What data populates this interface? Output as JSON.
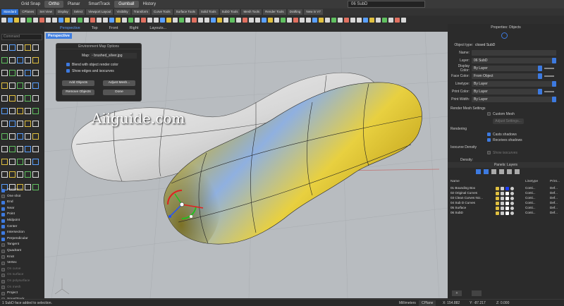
{
  "topbar": {
    "items": [
      "Grid Snap",
      "Ortho",
      "Planar",
      "SmartTrack",
      "Gumball",
      "History"
    ],
    "active": [
      false,
      true,
      false,
      false,
      true,
      false
    ],
    "object_name": "06 SubD"
  },
  "tabs": [
    "Standard",
    "CPlanes",
    "Set View",
    "Display",
    "Select",
    "Viewport Layout",
    "Visibility",
    "Transform",
    "Curve Tools",
    "Surface Tools",
    "Solid Tools",
    "SubD Tools",
    "Mesh Tools",
    "Render Tools",
    "Drafting",
    "New in V7"
  ],
  "left": {
    "command_placeholder": "Command",
    "snaps": [
      {
        "label": "Persistent",
        "on": true
      },
      {
        "label": "One shot",
        "on": false
      },
      {
        "label": "End",
        "on": true
      },
      {
        "label": "Near",
        "on": true
      },
      {
        "label": "Point",
        "on": true
      },
      {
        "label": "Midpoint",
        "on": true
      },
      {
        "label": "Center",
        "on": true
      },
      {
        "label": "Intersection",
        "on": true
      },
      {
        "label": "Perpendicular",
        "on": true
      },
      {
        "label": "Tangent",
        "on": false
      },
      {
        "label": "Quadrant",
        "on": false
      },
      {
        "label": "Knot",
        "on": false
      },
      {
        "label": "Vertex",
        "on": false
      },
      {
        "label": "On curve",
        "on": false,
        "dim": true
      },
      {
        "label": "On surface",
        "on": false,
        "dim": true
      },
      {
        "label": "On polysurface",
        "on": false,
        "dim": true
      },
      {
        "label": "On mesh",
        "on": false,
        "dim": true
      },
      {
        "label": "Project",
        "on": false
      },
      {
        "label": "SmartTrack",
        "on": false
      }
    ]
  },
  "viewport": {
    "tabs": [
      "Perspective",
      "Top",
      "Front",
      "Right",
      "Layouts..."
    ],
    "active_tab": "Perspective",
    "label": "Perspective",
    "watermark": "Aiiguide.com"
  },
  "env_dialog": {
    "title": "Environment Map Options",
    "map_label": "Map:",
    "map_value": "brushed_silver.jpg",
    "blend_label": "Blend with object render color",
    "show_edges_label": "Show edges and isocurves",
    "add_objects": "Add Objects",
    "adjust_mesh": "Adjust Mesh...",
    "remove_objects": "Remove Objects",
    "done": "Done"
  },
  "properties": {
    "header": "Properties: Objects",
    "object_type_label": "Object type:",
    "object_type_value": "closed SubD",
    "name_label": "Name:",
    "layer_label": "Layer:",
    "layer_value": "06 SubD",
    "display_color_label": "Display Color:",
    "display_color_value": "By Layer",
    "face_color_label": "Face Color:",
    "face_color_value": "From Object",
    "linetype_label": "Linetype:",
    "linetype_value": "By Layer",
    "print_color_label": "Print Color:",
    "print_color_value": "By Layer",
    "print_width_label": "Print Width:",
    "print_width_value": "By Layer",
    "render_mesh_label": "Render Mesh Settings",
    "custom_mesh_label": "Custom Mesh",
    "adjust_settings": "Adjust Settings...",
    "rendering_label": "Rendering",
    "casts_shadows": "Casts shadows",
    "receives_shadows": "Receives shadows",
    "isocurve_label": "Isocurve Density",
    "show_isocurves": "Show isocurves",
    "density_label": "Density:"
  },
  "layers": {
    "header": "Panels: Layers",
    "col_name": "Name",
    "col_linetype": "Linetype",
    "col_print": "Print...",
    "rows": [
      {
        "name": "01 Bounding Box",
        "linetype": "Conti...",
        "print": "Def...",
        "color": "#1a3cff"
      },
      {
        "name": "02 Original Curves",
        "linetype": "Conti...",
        "print": "Def...",
        "color": "#ffffff"
      },
      {
        "name": "03 Clean Curves NU...",
        "linetype": "Conti...",
        "print": "Def...",
        "color": "#ffffff"
      },
      {
        "name": "04 Sub D Curves",
        "linetype": "Conti...",
        "print": "Def...",
        "color": "#ffffff"
      },
      {
        "name": "05 Surface",
        "linetype": "Conti...",
        "print": "Def...",
        "color": "#ffffff"
      },
      {
        "name": "06 SubD",
        "linetype": "Conti...",
        "print": "Def...",
        "color": "#ffffff"
      }
    ]
  },
  "status": {
    "message": "1 SubD face added to selection.",
    "units": "Millimeters",
    "cplane": "CPlane",
    "x": "X: 154.882",
    "y": "Y: -87.217",
    "z": "Z: 0.000"
  },
  "colors": {
    "accent": "#3d7ae0",
    "viewport_bg": "#b8bcc0",
    "panel_bg": "#2b2b2b"
  }
}
